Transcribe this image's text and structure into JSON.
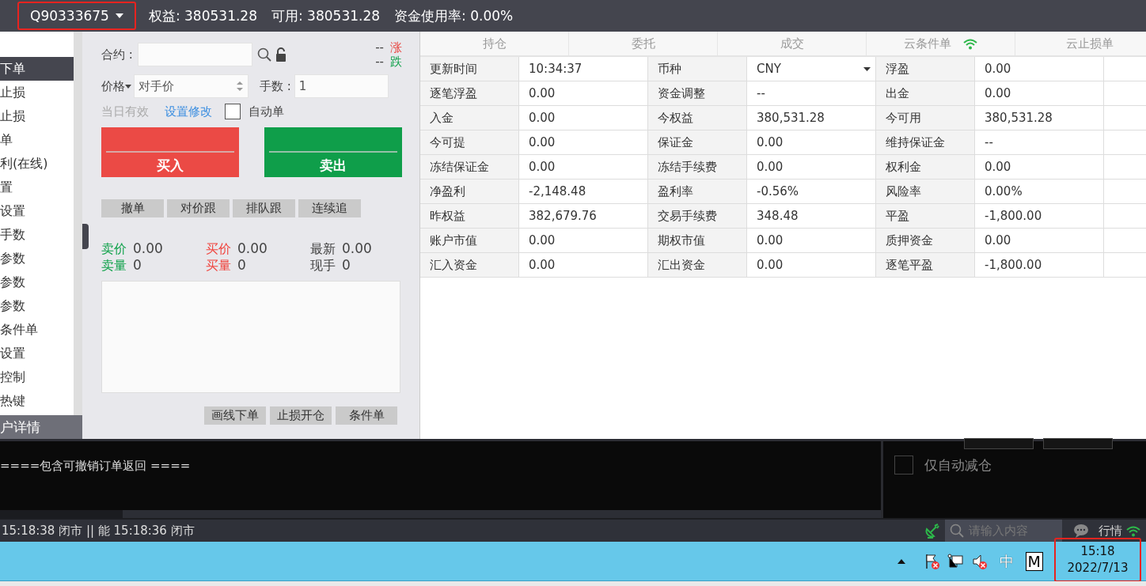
{
  "top_bar": {
    "account": {
      "label": "Q90333675",
      "highlighted": true
    },
    "stats": [
      "权益: 380531.28",
      "可用: 380531.28",
      "资金使用率: 0.00%"
    ]
  },
  "sidebar": {
    "items": [
      {
        "label": "下单",
        "selected": true
      },
      {
        "label": "止损",
        "selected": false
      },
      {
        "label": "止损",
        "selected": false
      },
      {
        "label": "单",
        "selected": false
      },
      {
        "label": "利(在线)",
        "selected": false
      },
      {
        "label": "置",
        "selected": false
      },
      {
        "label": "设置",
        "selected": false
      },
      {
        "label": "手数",
        "selected": false
      },
      {
        "label": "参数",
        "selected": false
      },
      {
        "label": "参数",
        "selected": false
      },
      {
        "label": "参数",
        "selected": false
      },
      {
        "label": "条件单",
        "selected": false
      },
      {
        "label": "设置",
        "selected": false
      },
      {
        "label": "控制",
        "selected": false
      },
      {
        "label": "热键",
        "selected": false
      }
    ],
    "footer": "户详情"
  },
  "order_panel": {
    "contract_label": "合约 :",
    "rise": {
      "value": "--",
      "label": "涨",
      "color": "#e84a45"
    },
    "fall": {
      "value": "--",
      "label": "跌",
      "color": "#12a24c"
    },
    "price_label": "价格",
    "price_placeholder": "对手价",
    "qty_label": "手数 :",
    "qty_value": "1",
    "validity": "当日有效",
    "settings_link": "设置修改",
    "auto_order": {
      "label": "自动单",
      "checked": false
    },
    "buy": "买入",
    "sell": "卖出",
    "actions": [
      "撤单",
      "对价跟",
      "排队跟",
      "连续追"
    ],
    "quotes": [
      {
        "label": "卖价",
        "value": "0.00",
        "color": "#12a24c"
      },
      {
        "label": "买价",
        "value": "0.00",
        "color": "#f0453f"
      },
      {
        "label": "最新",
        "value": "0.00",
        "color": "#404040"
      },
      {
        "label": "卖量",
        "value": "0",
        "color": "#12a24c"
      },
      {
        "label": "买量",
        "value": "0",
        "color": "#f0453f"
      },
      {
        "label": "现手",
        "value": "0",
        "color": "#404040"
      }
    ],
    "bottom_buttons": [
      "画线下单",
      "止损开仓",
      "条件单"
    ]
  },
  "account_table": {
    "tabs": [
      {
        "label": "持仓",
        "selected": false,
        "signal": false
      },
      {
        "label": "委托",
        "selected": false,
        "signal": false
      },
      {
        "label": "成交",
        "selected": false,
        "signal": false
      },
      {
        "label": "云条件单",
        "selected": false,
        "signal": true
      },
      {
        "label": "云止损单",
        "selected": false,
        "signal": false
      }
    ],
    "rows": [
      [
        "更新时间",
        "10:34:37",
        "币种",
        {
          "text": "CNY",
          "kind": "dropdown"
        },
        "浮盈",
        "0.00"
      ],
      [
        "逐笔浮盈",
        "0.00",
        "资金调整",
        "--",
        "出金",
        "0.00"
      ],
      [
        "入金",
        "0.00",
        "今权益",
        "380,531.28",
        "今可用",
        "380,531.28"
      ],
      [
        "今可提",
        "0.00",
        "保证金",
        "0.00",
        "维持保证金",
        "--"
      ],
      [
        "冻结保证金",
        "0.00",
        "冻结手续费",
        "0.00",
        "权利金",
        "0.00"
      ],
      [
        "净盈利",
        "-2,148.48",
        "盈利率",
        "-0.56%",
        "风险率",
        "0.00%"
      ],
      [
        "昨权益",
        "382,679.76",
        "交易手续费",
        "348.48",
        "平盈",
        "-1,800.00"
      ],
      [
        "账户市值",
        "0.00",
        "期权市值",
        "0.00",
        "质押资金",
        "0.00"
      ],
      [
        "汇入资金",
        "0.00",
        "汇出资金",
        "0.00",
        "逐笔平盈",
        "-1,800.00"
      ]
    ]
  },
  "log": {
    "lines": [
      "====包含可撤销订单返回 ===="
    ],
    "reduce_only": {
      "label": "仅自动减仓",
      "checked": false
    }
  },
  "status_bar": {
    "text": "15:18:38  闭市 || 能 15:18:36  闭市",
    "search_placeholder": "请输入内容",
    "market_label": "行情"
  },
  "taskbar": {
    "ime": "中",
    "keyboard": "M",
    "time": "15:18",
    "date": "2022/7/13",
    "highlighted": true
  }
}
